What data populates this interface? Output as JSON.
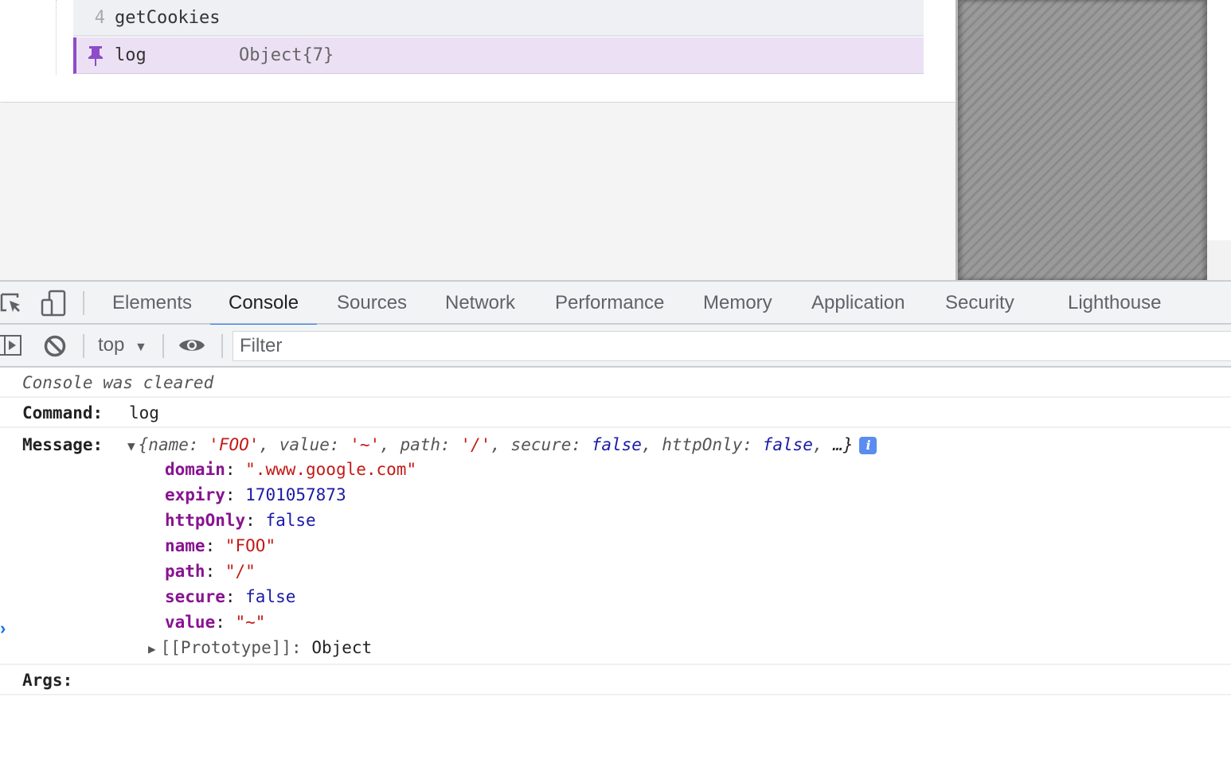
{
  "page": {
    "list": [
      {
        "index": "4",
        "name": "getCookies",
        "value": ""
      },
      {
        "index": "",
        "name": "log",
        "value": "Object{7}",
        "pinned": true,
        "icon": "pin-icon"
      }
    ]
  },
  "devtools": {
    "tabs": [
      {
        "label": "Elements",
        "active": false
      },
      {
        "label": "Console",
        "active": true
      },
      {
        "label": "Sources",
        "active": false
      },
      {
        "label": "Network",
        "active": false
      },
      {
        "label": "Performance",
        "active": false
      },
      {
        "label": "Memory",
        "active": false
      },
      {
        "label": "Application",
        "active": false
      },
      {
        "label": "Security",
        "active": false
      },
      {
        "label": "Lighthouse",
        "active": false
      }
    ],
    "toolbar_icons": [
      "inspect-element-icon",
      "device-toolbar-icon"
    ],
    "console_toolbar": {
      "sidebar_icon": "show-sidebar-icon",
      "clear_icon": "clear-console-icon",
      "context": "top",
      "eye_icon": "live-expression-icon",
      "filter_placeholder": "Filter"
    },
    "accent_color": "#1a73e8"
  },
  "console": {
    "cleared_message": "Console was cleared",
    "command_label": "Command:",
    "command_value": "log",
    "message_label": "Message:",
    "preview": {
      "open": "{",
      "parts": [
        {
          "key": "name",
          "value": "'FOO'",
          "type": "str"
        },
        {
          "key": "value",
          "value": "'~'",
          "type": "str"
        },
        {
          "key": "path",
          "value": "'/'",
          "type": "str"
        },
        {
          "key": "secure",
          "value": "false",
          "type": "bool"
        },
        {
          "key": "httpOnly",
          "value": "false",
          "type": "bool"
        }
      ],
      "ellipsis": "…}",
      "info_badge": "i"
    },
    "properties": [
      {
        "key": "domain",
        "value": "\".www.google.com\"",
        "type": "str"
      },
      {
        "key": "expiry",
        "value": "1701057873",
        "type": "num"
      },
      {
        "key": "httpOnly",
        "value": "false",
        "type": "bool"
      },
      {
        "key": "name",
        "value": "\"FOO\"",
        "type": "str"
      },
      {
        "key": "path",
        "value": "\"/\"",
        "type": "str"
      },
      {
        "key": "secure",
        "value": "false",
        "type": "bool"
      },
      {
        "key": "value",
        "value": "\"~\"",
        "type": "str"
      }
    ],
    "prototype": {
      "key": "[[Prototype]]",
      "value": "Object"
    },
    "args_label": "Args:",
    "prompt_symbol": "›"
  }
}
